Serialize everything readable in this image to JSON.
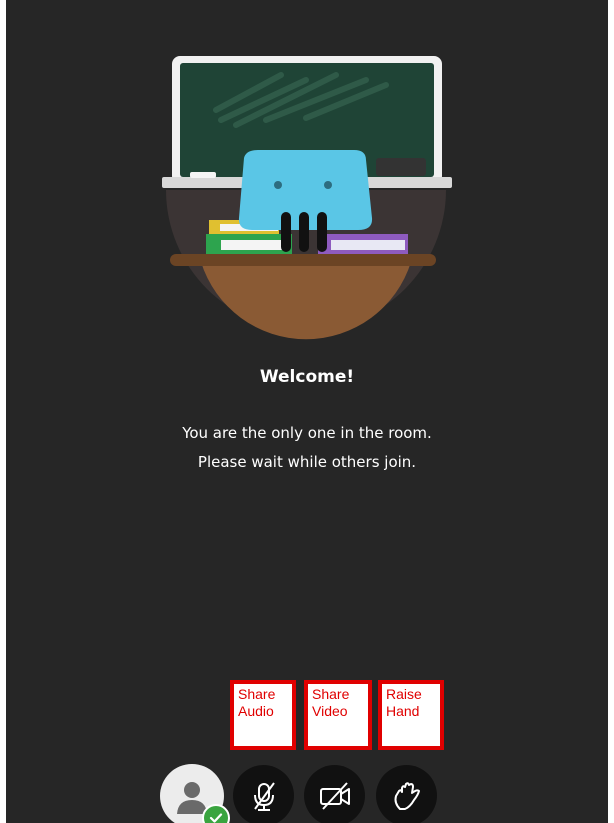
{
  "welcome": {
    "title": "Welcome!",
    "line1": "You are the only one in the room.",
    "line2": "Please wait while others join."
  },
  "callouts": {
    "share_audio": [
      "Share",
      "Audio"
    ],
    "share_video": [
      "Share",
      "Video"
    ],
    "raise_hand": [
      "Raise",
      "Hand"
    ]
  },
  "controls": [
    {
      "name": "avatar",
      "icon": "user-icon",
      "status_icon": "checkmark-icon"
    },
    {
      "name": "share-audio",
      "icon": "muted-microphone-icon"
    },
    {
      "name": "share-video",
      "icon": "camera-off-icon"
    },
    {
      "name": "raise-hand",
      "icon": "raise-hand-icon"
    }
  ],
  "colors": {
    "background": "#262626",
    "callout_red": "#e00000",
    "status_green": "#3aa43f"
  }
}
